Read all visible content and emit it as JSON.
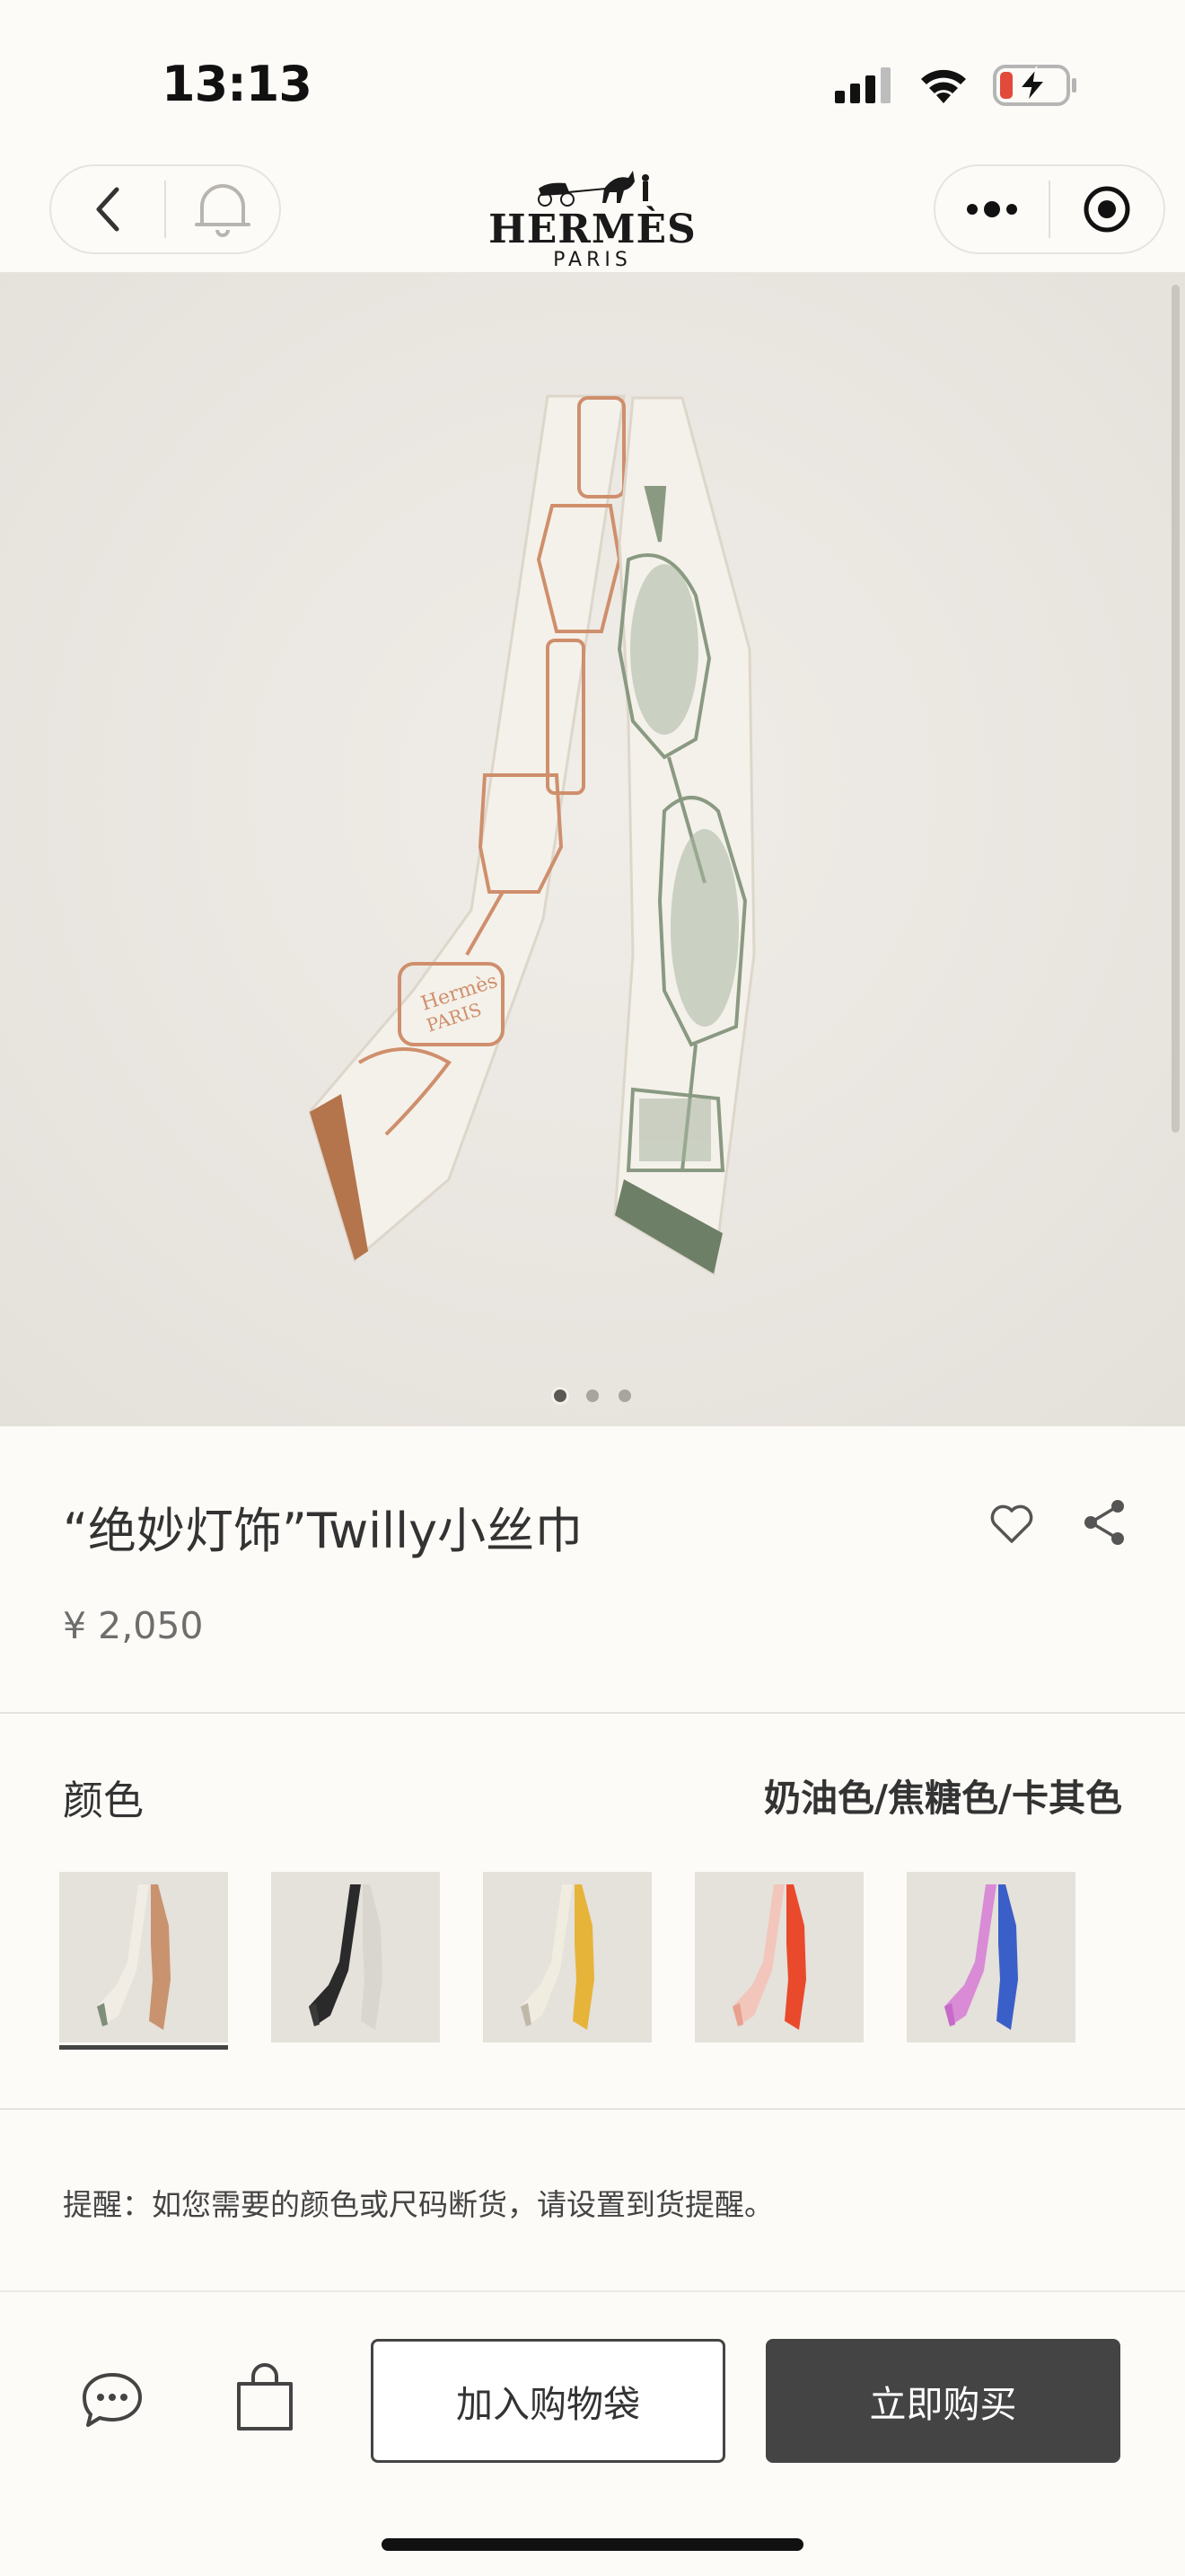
{
  "status_bar": {
    "time": "13:13",
    "icons": [
      "signal-icon",
      "wifi-icon",
      "battery-charging-icon"
    ],
    "battery_color": "#e24a3b"
  },
  "nav": {
    "brand_name": "HERMÈS",
    "brand_sub": "PARIS",
    "icons": [
      "back-icon",
      "bell-icon",
      "more-icon",
      "mini-program-close-icon"
    ]
  },
  "gallery": {
    "image_count": 3,
    "active_index": 0
  },
  "product": {
    "title": "“绝妙灯饰”Twilly小丝巾",
    "price": "¥ 2,050",
    "color_label": "颜色",
    "color_value": "奶油色/焦糖色/卡其色",
    "swatches": [
      {
        "name": "cream-caramel-khaki",
        "colors": [
          "#f1ede4",
          "#c9936f",
          "#7e8e78"
        ]
      },
      {
        "name": "black-white",
        "colors": [
          "#2a2a2a",
          "#d9d6d0",
          "#3a3a3a"
        ]
      },
      {
        "name": "white-yellow",
        "colors": [
          "#f0ece0",
          "#e7b43a",
          "#c0b9aa"
        ]
      },
      {
        "name": "pink-red",
        "colors": [
          "#f2c6bb",
          "#e94a2c",
          "#e8a18f"
        ]
      },
      {
        "name": "pink-blue",
        "colors": [
          "#d98bd6",
          "#3a5fc8",
          "#c56ac8"
        ]
      }
    ],
    "selected_swatch": 0,
    "reminder": "提醒：如您需要的颜色或尺码断货，请设置到货提醒。"
  },
  "bottom_bar": {
    "add_to_bag": "加入购物袋",
    "buy_now": "立即购买",
    "icons": [
      "chat-icon",
      "shopping-bag-icon"
    ]
  },
  "colors": {
    "background": "#fdfbf7",
    "gallery_bg": "#e9e5df",
    "primary_button": "#444444",
    "scarf_caramel": "#c9936f",
    "scarf_khaki": "#7e8e78"
  }
}
